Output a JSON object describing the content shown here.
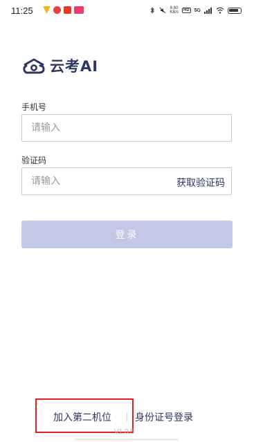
{
  "status_bar": {
    "time": "11:25",
    "network_speed": "6.60\nKB/s",
    "network_type": "5G",
    "hd_label": "HD"
  },
  "brand": {
    "name": "云考AI",
    "icon": "cloud-exam-logo-icon",
    "color": "#2d3561"
  },
  "form": {
    "phone": {
      "label": "手机号",
      "placeholder": "请输入"
    },
    "code": {
      "label": "验证码",
      "placeholder": "请输入",
      "get_code_label": "获取验证码"
    },
    "login_label": "登录",
    "login_color": "#c3c6e5"
  },
  "footer": {
    "join_second_camera": "加入第二机位",
    "id_card_login": "身份证号登录",
    "version": "V1.0.5",
    "highlight_color": "#e01f1f"
  }
}
